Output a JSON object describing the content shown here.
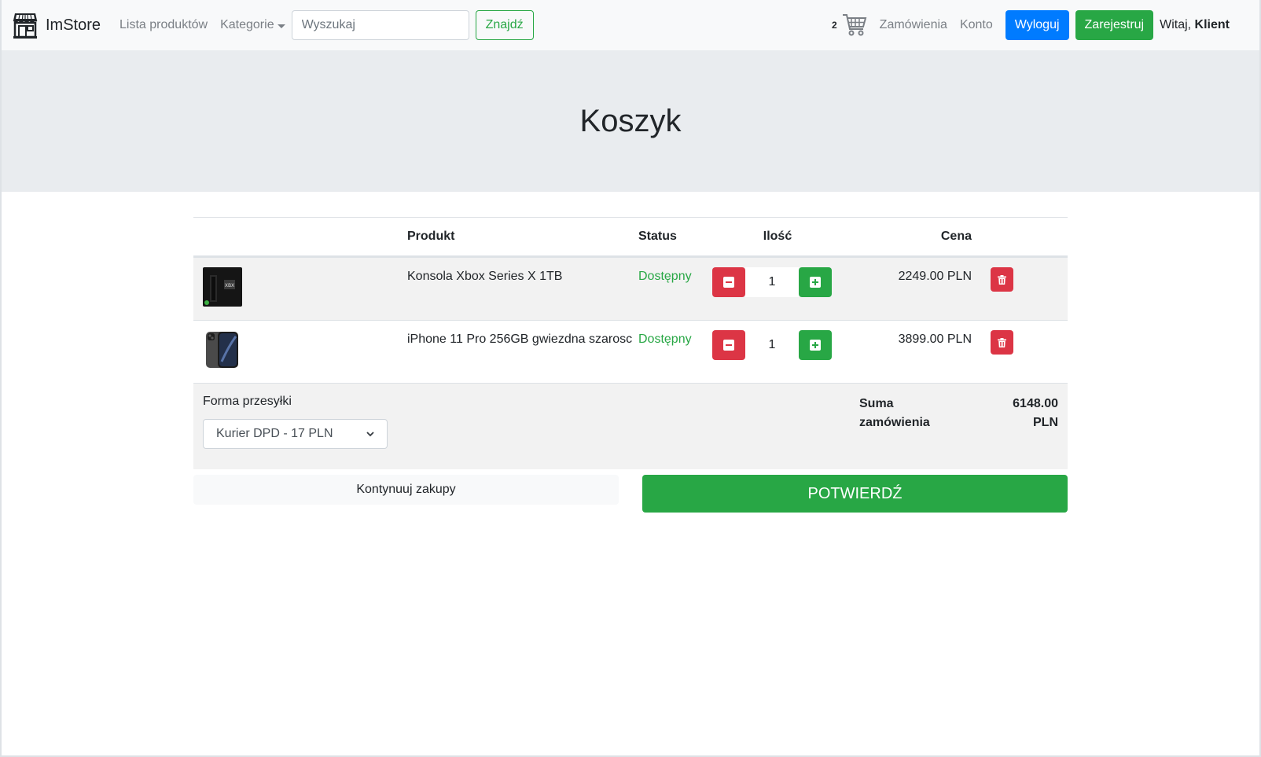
{
  "navbar": {
    "brand": "ImStore",
    "links": {
      "products": "Lista produktów",
      "categories": "Kategorie",
      "orders": "Zamówienia",
      "account": "Konto"
    },
    "search": {
      "placeholder": "Wyszukaj",
      "button": "Znajdź"
    },
    "cart_count": "2",
    "logout": "Wyloguj",
    "register": "Zarejestruj",
    "greeting_prefix": "Witaj,",
    "user_name": "Klient"
  },
  "page": {
    "title": "Koszyk"
  },
  "table": {
    "headers": {
      "product": "Produkt",
      "status": "Status",
      "quantity": "Ilość",
      "price": "Cena"
    },
    "rows": [
      {
        "name": "Konsola Xbox Series X 1TB",
        "status": "Dostępny",
        "qty": "1",
        "price": "2249.00 PLN",
        "thumb": "xbox-console"
      },
      {
        "name": "iPhone 11 Pro 256GB gwiezdna szarosc",
        "status": "Dostępny",
        "qty": "1",
        "price": "3899.00 PLN",
        "thumb": "iphone"
      }
    ]
  },
  "summary": {
    "shipping_label": "Forma przesyłki",
    "shipping_selected": "Kurier DPD - 17 PLN",
    "total_label": "Suma zamówienia",
    "total_value": "6148.00 PLN"
  },
  "actions": {
    "continue": "Kontynuuj zakupy",
    "confirm": "POTWIERDŹ"
  },
  "colors": {
    "primary": "#007bff",
    "success": "#28a745",
    "danger": "#dc3545",
    "jumbotron": "#e9ecef"
  }
}
